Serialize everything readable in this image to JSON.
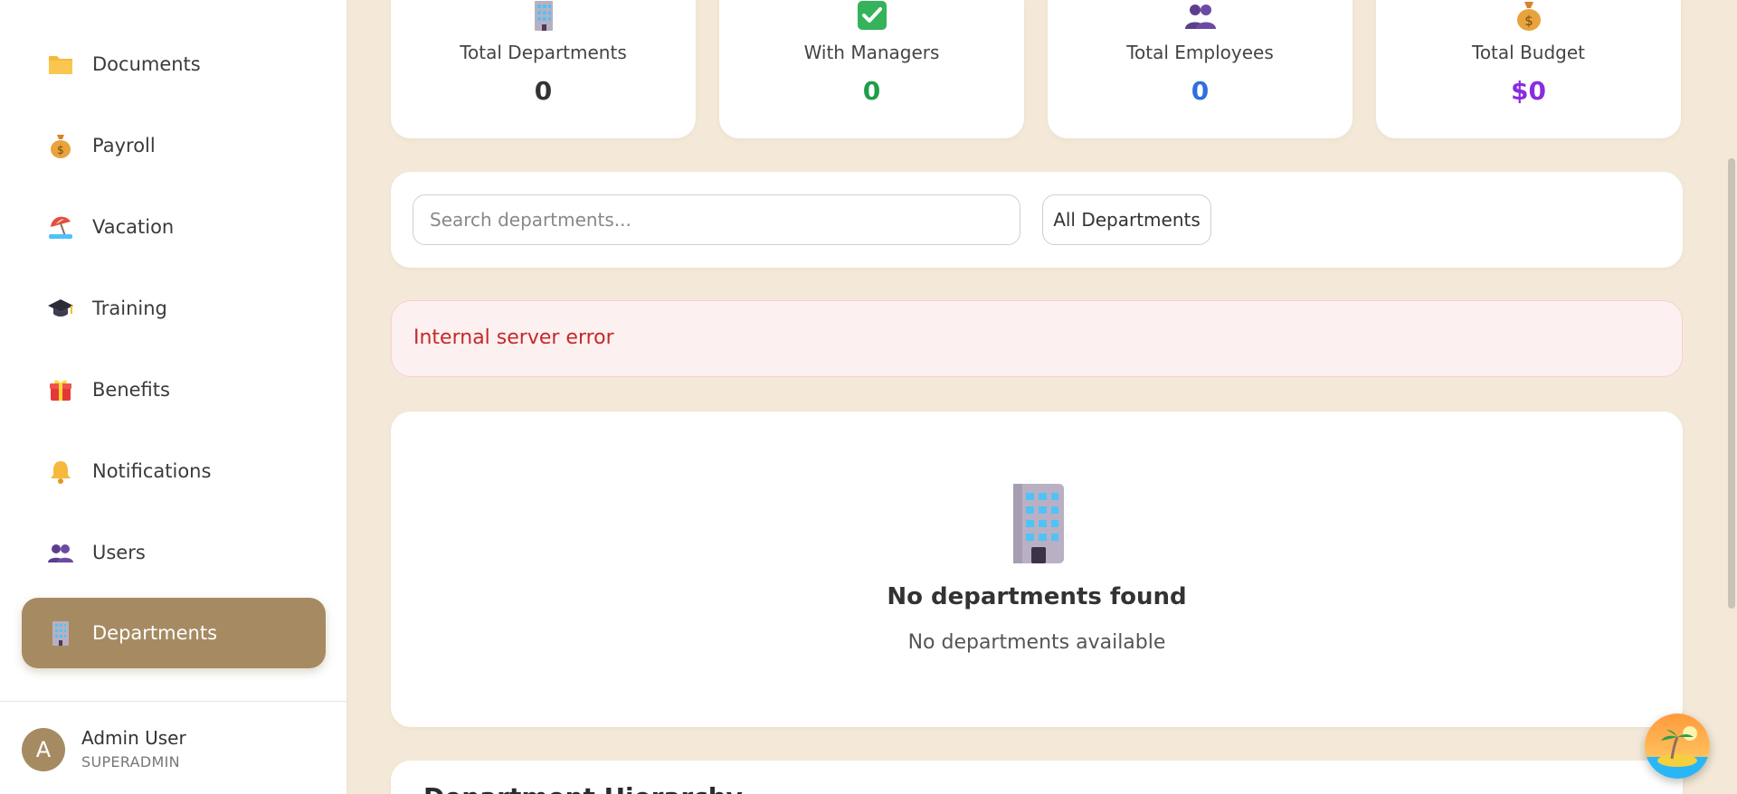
{
  "sidebar": {
    "items": [
      {
        "label": "Documents",
        "icon": "folder-icon"
      },
      {
        "label": "Payroll",
        "icon": "money-bag-icon"
      },
      {
        "label": "Vacation",
        "icon": "beach-umbrella-icon"
      },
      {
        "label": "Training",
        "icon": "graduation-cap-icon"
      },
      {
        "label": "Benefits",
        "icon": "gift-icon"
      },
      {
        "label": "Notifications",
        "icon": "bell-icon"
      },
      {
        "label": "Users",
        "icon": "users-icon"
      },
      {
        "label": "Departments",
        "icon": "office-building-icon",
        "active": true
      }
    ],
    "user": {
      "initial": "A",
      "name": "Admin User",
      "role": "SUPERADMIN"
    }
  },
  "stats": [
    {
      "label": "Total Departments",
      "value": "0",
      "color": "#333333",
      "icon": "office-building-icon"
    },
    {
      "label": "With Managers",
      "value": "0",
      "color": "#1f9d48",
      "icon": "check-mark-icon"
    },
    {
      "label": "Total Employees",
      "value": "0",
      "color": "#2f6fe0",
      "icon": "users-icon"
    },
    {
      "label": "Total Budget",
      "value": "$0",
      "color": "#8a2be2",
      "icon": "money-bag-icon"
    }
  ],
  "filters": {
    "search_placeholder": "Search departments...",
    "search_value": "",
    "department_select": "All Departments"
  },
  "error": {
    "message": "Internal server error"
  },
  "empty_state": {
    "title": "No departments found",
    "subtitle": "No departments available",
    "icon": "office-building-icon"
  },
  "hierarchy": {
    "title": "Department Hierarchy"
  },
  "colors": {
    "background": "#f4e9d8",
    "accent": "#a68b62",
    "error_text": "#c62828",
    "error_bg": "#fdf0f0"
  }
}
